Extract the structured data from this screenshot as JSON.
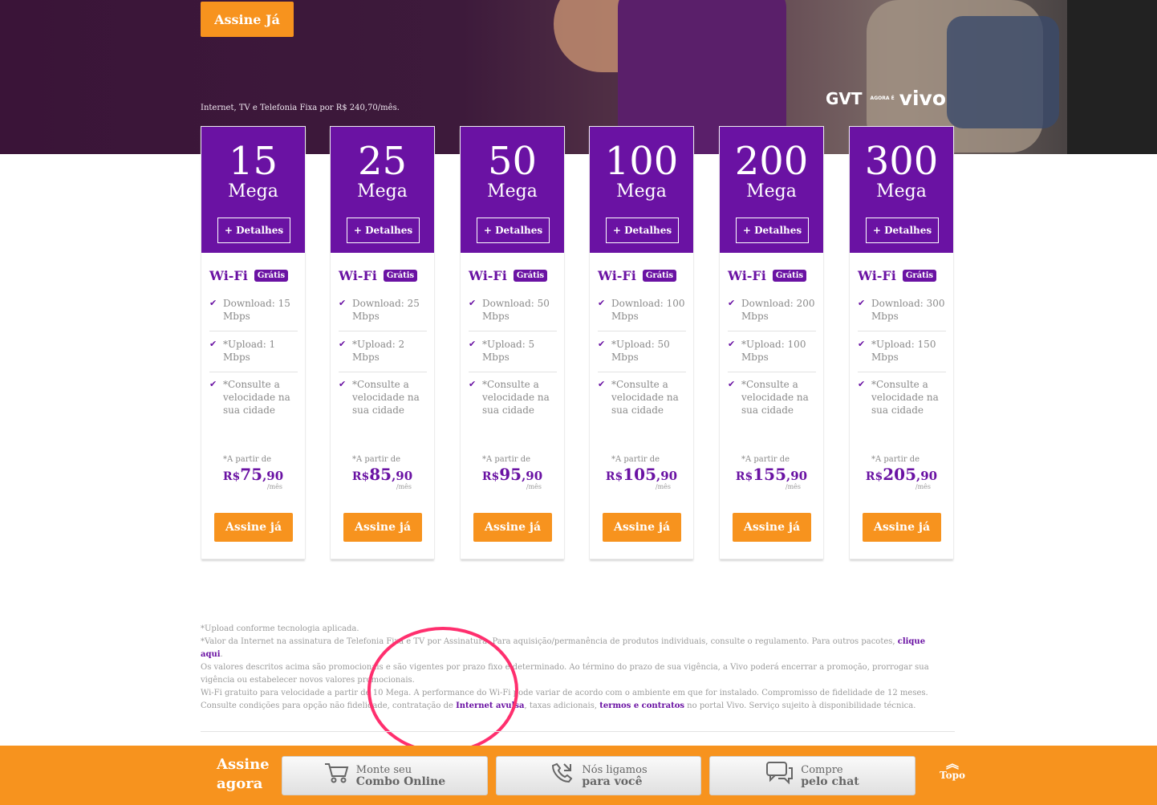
{
  "hero": {
    "cta_label": "Assine Já",
    "tagline": "Internet, TV e Telefonia Fixa por R$ 240,70/mês.",
    "logo": {
      "left": "GVT",
      "middle": "AGORA É",
      "right": "vivo"
    }
  },
  "plans": [
    {
      "speed": "15",
      "unit": "Mega",
      "details": "+ Detalhes",
      "wifi": "Wi-Fi",
      "badge": "Grátis",
      "features": [
        "Download: 15 Mbps",
        "*Upload: 1 Mbps",
        "*Consulte a velocidade na sua cidade"
      ],
      "price_from": "*A partir de",
      "currency": "R$",
      "price_int": "75",
      "price_dec": ",90",
      "per": "/mês",
      "buy": "Assine já"
    },
    {
      "speed": "25",
      "unit": "Mega",
      "details": "+ Detalhes",
      "wifi": "Wi-Fi",
      "badge": "Grátis",
      "features": [
        "Download: 25 Mbps",
        "*Upload: 2 Mbps",
        "*Consulte a velocidade na sua cidade"
      ],
      "price_from": "*A partir de",
      "currency": "R$",
      "price_int": "85",
      "price_dec": ",90",
      "per": "/mês",
      "buy": "Assine já"
    },
    {
      "speed": "50",
      "unit": "Mega",
      "details": "+ Detalhes",
      "wifi": "Wi-Fi",
      "badge": "Grátis",
      "features": [
        "Download: 50 Mbps",
        "*Upload: 5 Mbps",
        "*Consulte a velocidade na sua cidade"
      ],
      "price_from": "*A partir de",
      "currency": "R$",
      "price_int": "95",
      "price_dec": ",90",
      "per": "/mês",
      "buy": "Assine já"
    },
    {
      "speed": "100",
      "unit": "Mega",
      "details": "+ Detalhes",
      "wifi": "Wi-Fi",
      "badge": "Grátis",
      "features": [
        "Download: 100 Mbps",
        "*Upload: 50 Mbps",
        "*Consulte a velocidade na sua cidade"
      ],
      "price_from": "*A partir de",
      "currency": "R$",
      "price_int": "105",
      "price_dec": ",90",
      "per": "/mês",
      "buy": "Assine já"
    },
    {
      "speed": "200",
      "unit": "Mega",
      "details": "+ Detalhes",
      "wifi": "Wi-Fi",
      "badge": "Grátis",
      "features": [
        "Download: 200 Mbps",
        "*Upload: 100 Mbps",
        "*Consulte a velocidade na sua cidade"
      ],
      "price_from": "*A partir de",
      "currency": "R$",
      "price_int": "155",
      "price_dec": ",90",
      "per": "/mês",
      "buy": "Assine já"
    },
    {
      "speed": "300",
      "unit": "Mega",
      "details": "+ Detalhes",
      "wifi": "Wi-Fi",
      "badge": "Grátis",
      "features": [
        "Download: 300 Mbps",
        "*Upload: 150 Mbps",
        "*Consulte a velocidade na sua cidade"
      ],
      "price_from": "*A partir de",
      "currency": "R$",
      "price_int": "205",
      "price_dec": ",90",
      "per": "/mês",
      "buy": "Assine já"
    }
  ],
  "notes": {
    "line1": "*Upload conforme tecnologia aplicada.",
    "line2_a": "*Valor da Internet na assinatura de Telefonia Fixa e TV por Assinatura. Para aquisição/permanência de produtos individuais, consulte o regulamento. Para outros pacotes, ",
    "line2_link": "clique aqui",
    "line2_b": ".",
    "line3": "Os valores descritos acima são promocionais e são vigentes por prazo fixo e determinado. Ao término do prazo de sua vigência, a Vivo poderá encerrar a promoção, prorrogar sua vigência ou estabelecer novos valores promocionais.",
    "line4_a": "Wi-Fi gratuito para velocidade a partir de 10 Mega. A performance do Wi-Fi pode variar de acordo com o ambiente em que for instalado. Compromisso de fidelidade de 12 meses. Consulte condições para opção não fidelidade, contratação de ",
    "line4_link1": "Internet avulsa",
    "line4_b": ", taxas adicionais, ",
    "line4_link2": "termos e contratos",
    "line4_c": " no portal Vivo. Serviço sujeito à disponibilidade técnica."
  },
  "footer": {
    "assine_line1": "Assine",
    "assine_line2": "agora",
    "buttons": [
      {
        "icon": "cart-icon",
        "line1": "Monte seu",
        "line2": "Combo Online"
      },
      {
        "icon": "phone-icon",
        "line1": "Nós ligamos",
        "line2": "para você"
      },
      {
        "icon": "chat-icon",
        "line1": "Compre",
        "line2": "pelo chat"
      }
    ],
    "top_label": "Topo"
  },
  "colors": {
    "purple": "#6a12a3",
    "orange": "#f7931e",
    "highlight": "#ff2f6e"
  }
}
